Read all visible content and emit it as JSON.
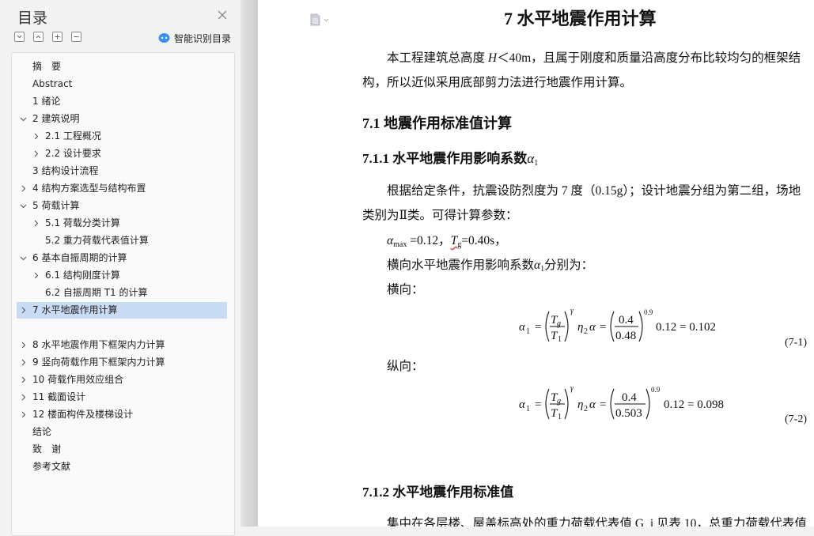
{
  "sidebar": {
    "title": "目录",
    "smart_toc_label": "智能识别目录",
    "items": [
      {
        "label": "摘　要",
        "level": 0,
        "arrow": "none"
      },
      {
        "label": "Abstract",
        "level": 0,
        "arrow": "none"
      },
      {
        "label": "1 绪论",
        "level": 0,
        "arrow": "none"
      },
      {
        "label": "2 建筑说明",
        "level": 0,
        "arrow": "down"
      },
      {
        "label": "2.1 工程概况",
        "level": 1,
        "arrow": "right"
      },
      {
        "label": "2.2 设计要求",
        "level": 1,
        "arrow": "right"
      },
      {
        "label": "3 结构设计流程",
        "level": 0,
        "arrow": "none"
      },
      {
        "label": "4 结构方案选型与结构布置",
        "level": 0,
        "arrow": "right"
      },
      {
        "label": "5 荷载计算",
        "level": 0,
        "arrow": "down"
      },
      {
        "label": "5.1 荷载分类计算",
        "level": 1,
        "arrow": "right"
      },
      {
        "label": "5.2 重力荷载代表值计算",
        "level": 1,
        "arrow": "none"
      },
      {
        "label": "6 基本自振周期的计算",
        "level": 0,
        "arrow": "down"
      },
      {
        "label": "6.1  结构刚度计算",
        "level": 1,
        "arrow": "right"
      },
      {
        "label": "6.2 自振周期 T1 的计算",
        "level": 1,
        "arrow": "none"
      },
      {
        "label": "7 水平地震作用计算",
        "level": 0,
        "arrow": "right",
        "active": true
      },
      {
        "label": "8 水平地震作用下框架内力计算",
        "level": 0,
        "arrow": "right"
      },
      {
        "label": "9 竖向荷载作用下框架内力计算",
        "level": 0,
        "arrow": "right"
      },
      {
        "label": "10 荷载作用效应组合",
        "level": 0,
        "arrow": "right"
      },
      {
        "label": "11 截面设计",
        "level": 0,
        "arrow": "right"
      },
      {
        "label": "12 楼面构件及楼梯设计",
        "level": 0,
        "arrow": "right"
      },
      {
        "label": "结论",
        "level": 0,
        "arrow": "none"
      },
      {
        "label": "致　谢",
        "level": 0,
        "arrow": "none"
      },
      {
        "label": "参考文献",
        "level": 0,
        "arrow": "none"
      }
    ]
  },
  "document": {
    "chapter_title": "7 水平地震作用计算",
    "intro_line1_a": "本工程建筑总高度 ",
    "intro_H": "H",
    "intro_line1_b": "＜40m，且属于刚度和质量沿高度分布比较均匀的框架结",
    "intro_line2": "构，所以近似采用底部剪力法进行地震作用计算。",
    "h_7_1": "7.1 地震作用标准值计算",
    "h_7_1_1_text": "7.1.1 水平地震作用影响系数",
    "h_7_1_1_sym": "α",
    "h_7_1_1_sub": "1",
    "para2_line1": "根据给定条件，抗震设防烈度为 7 度（0.15g）；设计地震分组为第二组，场地",
    "para2_line2": "类别为Ⅱ类。可得计算参数：",
    "params_alpha": "α",
    "params_alpha_sub": "max",
    "params_alpha_val": " =0.12，",
    "params_T": "T",
    "params_T_sub": "g",
    "params_T_val": "=0.40s，",
    "coef_line_a": "横向水平地震作用影响系数",
    "coef_line_sym": "α",
    "coef_line_sub": "1",
    "coef_line_b": "分别为：",
    "transverse_label": "横向：",
    "longitudinal_label": "纵向：",
    "eq1": {
      "num_val": "0.4",
      "den_val": "0.48",
      "exp": "0.9",
      "tail": "0.12 = 0.102",
      "number": "(7-1)"
    },
    "eq2": {
      "num_val": "0.4",
      "den_val": "0.503",
      "exp": "0.9",
      "tail": "0.12 = 0.098",
      "number": "(7-2)"
    },
    "h_7_1_2": "7.1.2 水平地震作用标准值",
    "bottom_line": "集中在各层楼、屋盖标高处的重力荷载代表值 G_i 见表 10，总重力荷载代表值"
  }
}
